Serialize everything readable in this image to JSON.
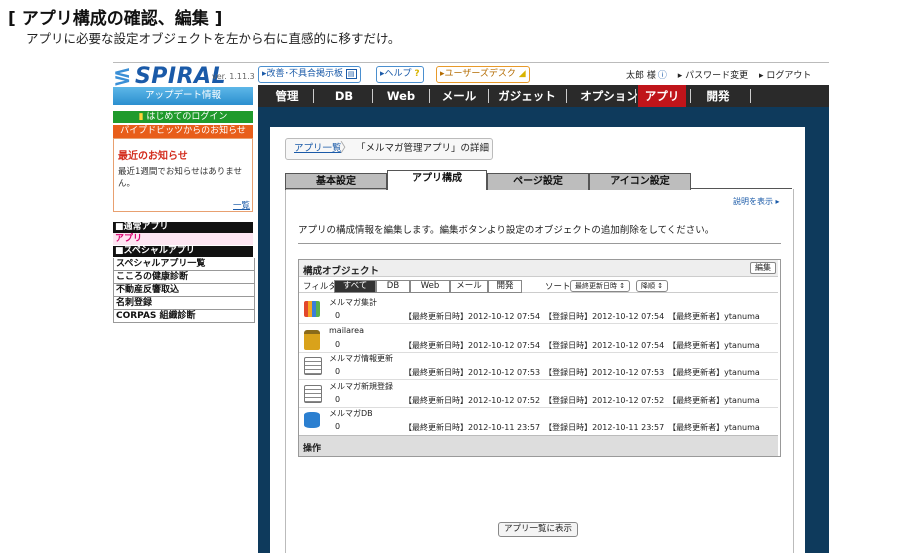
{
  "page": {
    "title": "[ アプリ構成の確認、編集 ]",
    "subtitle": "アプリに必要な設定オブジェクトを左から右に直感的に移すだけ。"
  },
  "header": {
    "logo": "SPIRAL",
    "version": "ver. 1.11.3",
    "buttons": [
      "▸改善･不具合掲示板",
      "▸ヘルプ",
      "▸ユーザーズデスク"
    ],
    "user": "太郎 様",
    "password_link": "▸ パスワード変更",
    "logout_link": "▸ ログアウト"
  },
  "nav": {
    "items": [
      "管理",
      "DB",
      "Web",
      "メール",
      "ガジェット",
      "オプション",
      "アプリ",
      "開発"
    ],
    "active": "アプリ",
    "active_color": "#c0141a"
  },
  "sidebar": {
    "update_label": "アップデート情報",
    "first_login": "はじめてのログイン",
    "notice_header": "パイプドビッツからのお知らせ",
    "notice_title": "最近のお知らせ",
    "notice_text": "最近1週間でお知らせはありません。",
    "notice_link": "一覧",
    "normal_section": "■通常アプリ",
    "normal_items": [
      "アプリ"
    ],
    "special_section": "■スペシャルアプリ",
    "special_items": [
      "スペシャルアプリ一覧",
      "こころの健康診断",
      "不動産反響取込",
      "名刺登録",
      "CORPAS 組織診断"
    ]
  },
  "main": {
    "breadcrumb_link": "アプリ一覧",
    "breadcrumb_current": "「メルマガ管理アプリ」の詳細",
    "tabs": [
      "基本設定",
      "アプリ構成",
      "ページ設定",
      "アイコン設定"
    ],
    "active_tab": "アプリ構成",
    "help_link": "説明を表示 ▸",
    "description": "アプリの構成情報を編集します。編集ボタンより設定のオブジェクトの追加削除をしてください。",
    "objects_title": "構成オブジェクト",
    "edit_label": "編集",
    "filter_label": "フィルタ",
    "filters": [
      "すべて",
      "DB",
      "Web",
      "メール",
      "開発"
    ],
    "sort_label": "ソート",
    "sort_field": "最終更新日時 ↕",
    "sort_order": "降順 ↕",
    "objects": [
      {
        "name": "メルマガ集計",
        "count": "0",
        "meta": "【最終更新日時】2012-10-12 07:54　【登録日時】2012-10-12 07:54　【最終更新者】ytanuma",
        "icon": "chart-icon"
      },
      {
        "name": "mailarea",
        "count": "0",
        "meta": "【最終更新日時】2012-10-12 07:54　【登録日時】2012-10-12 07:54　【最終更新者】ytanuma",
        "icon": "lock-icon"
      },
      {
        "name": "メルマガ情報更新",
        "count": "0",
        "meta": "【最終更新日時】2012-10-12 07:53　【登録日時】2012-10-12 07:53　【最終更新者】ytanuma",
        "icon": "form-icon"
      },
      {
        "name": "メルマガ新規登録",
        "count": "0",
        "meta": "【最終更新日時】2012-10-12 07:52　【登録日時】2012-10-12 07:52　【最終更新者】ytanuma",
        "icon": "form-icon"
      },
      {
        "name": "メルマガDB",
        "count": "0",
        "meta": "【最終更新日時】2012-10-11 23:57　【登録日時】2012-10-11 23:57　【最終更新者】ytanuma",
        "icon": "database-icon"
      }
    ],
    "operations_label": "操作",
    "show_in_list": "アプリ一覧に表示"
  }
}
